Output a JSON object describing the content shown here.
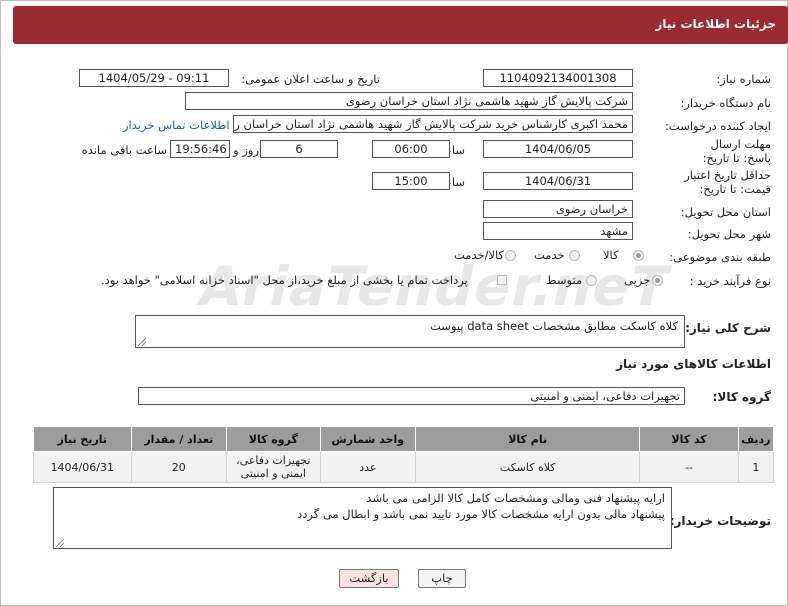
{
  "header": {
    "title": "جزئیات اطلاعات نیاز"
  },
  "labels": {
    "need_number": "شماره نیاز:",
    "announce_datetime": "تاریخ و ساعت اعلان عمومی:",
    "buyer_org": "نام دستگاه خریدار:",
    "requester": "ایجاد کننده درخواست:",
    "reply_deadline": "مهلت ارسال پاسخ: تا تاریخ:",
    "time": "ساعت",
    "days_and": "روز و",
    "remaining": "ساعت باقی مانده",
    "price_validity": "حداقل تاریخ اعتبار قیمت: تا تاریخ:",
    "delivery_province": "استان محل تحویل:",
    "delivery_city": "شهر محل تحویل:",
    "category": "طبقه بندی موضوعی:",
    "process_type": "نوع فرآیند خرید :",
    "description": "شرح کلی نیاز:",
    "goods_info": "اطلاعات کالاهای مورد نیاز",
    "goods_group": "گروه کالا:",
    "buyer_notes": "توضیحات خریدار:"
  },
  "values": {
    "need_number": "1104092134001308",
    "announce_datetime": "1404/05/29 - 09:11",
    "buyer_org": "شرکت پالایش گاز شهید هاشمی نژاد   استان خراسان رضوی",
    "requester": "محمد اکبری کارشناس خرید شرکت پالایش گاز شهید هاشمی نژاد   استان خراسان رضوی",
    "contact_link": "اطلاعات تماس خریدار",
    "reply_date": "1404/06/05",
    "reply_time": "06:00",
    "days": "6",
    "remaining_time": "19:56:46",
    "price_date": "1404/06/31",
    "price_time": "15:00",
    "province": "خراسان رضوی",
    "city": "مشهد",
    "description": "کلاه کاسکت مطابق مشخصات data sheet پیوست",
    "goods_group": "تجهیزات دفاعی، ایمنی و امنیتی",
    "buyer_notes_line1": "ارایه پیشنهاد فنی ومالی ومشخصات کامل کالا الزامی می باشد",
    "buyer_notes_line2": "پیشنهاد مالی بدون ارایه مشخصات کالا مورد تایید نمی باشد و ابطال می گردد"
  },
  "category_options": [
    "کالا",
    "خدمت",
    "کالا/خدمت"
  ],
  "category_selected": "کالا",
  "process_options": [
    "جزیی",
    "متوسط"
  ],
  "process_selected": "جزیی",
  "payment_note": "پرداخت تمام یا بخشی از مبلغ خرید،از محل \"اسناد خزانه اسلامی\" خواهد بود.",
  "table": {
    "headers": [
      "ردیف",
      "کد کالا",
      "نام کالا",
      "واحد شمارش",
      "گروه کالا",
      "تعداد / مقدار",
      "تاریخ نیاز"
    ],
    "rows": [
      [
        "1",
        "--",
        "کلاه کاسکت",
        "عدد",
        "تجهیزات دفاعی، ایمنی و امنیتی",
        "20",
        "1404/06/31"
      ]
    ]
  },
  "buttons": {
    "print": "چاپ",
    "back": "بازگشت"
  },
  "watermark": "AriaTender.neT",
  "colors": {
    "header_bg": "#9c2a31",
    "table_header_bg": "#9c9c9c",
    "link": "#1a5fb4",
    "back_button_bg": "#fbe3e4"
  }
}
